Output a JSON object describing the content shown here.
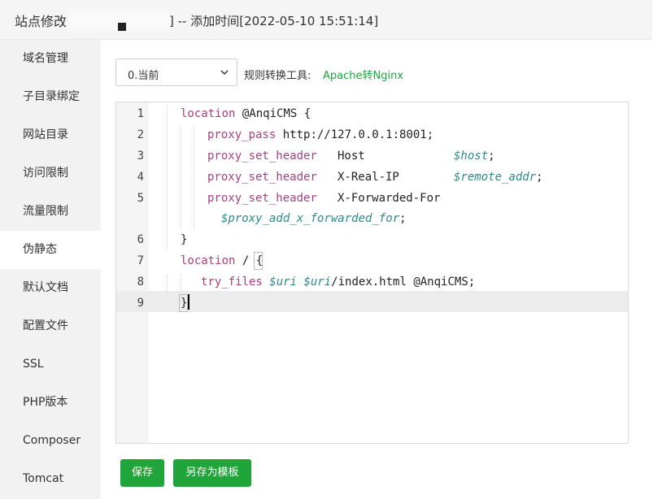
{
  "header": {
    "title_left": "站点修改",
    "title_added": "] -- 添加时间[2022-05-10 15:51:14]"
  },
  "sidebar": {
    "items": [
      {
        "label": "域名管理"
      },
      {
        "label": "子目录绑定"
      },
      {
        "label": "网站目录"
      },
      {
        "label": "访问限制"
      },
      {
        "label": "流量限制"
      },
      {
        "label": "伪静态",
        "active": true
      },
      {
        "label": "默认文档"
      },
      {
        "label": "配置文件"
      },
      {
        "label": "SSL"
      },
      {
        "label": "PHP版本"
      },
      {
        "label": "Composer"
      },
      {
        "label": "Tomcat"
      }
    ]
  },
  "toolbar": {
    "select_value": "0.当前",
    "select_icon": "chevron-down-icon",
    "tool_label": "规则转换工具:",
    "tool_link": "Apache转Nginx"
  },
  "editor": {
    "line_numbers": [
      "1",
      "2",
      "3",
      "4",
      "5",
      "6",
      "7",
      "8",
      "9"
    ],
    "active_line": 9,
    "lines": {
      "l1a": "location",
      "l1b": " @AnqiCMS {",
      "l2a": "proxy_pass",
      "l2b": " http://127.0.0.1:8001;",
      "l3a": "proxy_set_header",
      "l3b": "Host",
      "l3c": "$host",
      "l3d": ";",
      "l4a": "proxy_set_header",
      "l4b": "X-Real-IP",
      "l4c": "$remote_addr",
      "l4d": ";",
      "l5a": "proxy_set_header",
      "l5b": "X-Forwarded-For",
      "l5c": "$proxy_add_x_forwarded_for",
      "l5d": ";",
      "l6": "}",
      "l7a": "location",
      "l7b": " / ",
      "l7c": "{",
      "l8a": "try_files",
      "l8b": "$uri",
      "l8c": "$uri",
      "l8d": "/index.html @AnqiCMS;",
      "l9": "}"
    }
  },
  "buttons": {
    "save": "保存",
    "save_template": "另存为模板"
  },
  "colors": {
    "accent": "#20a53a",
    "keyword": "#a6417f",
    "variable": "#2b8a8a"
  }
}
